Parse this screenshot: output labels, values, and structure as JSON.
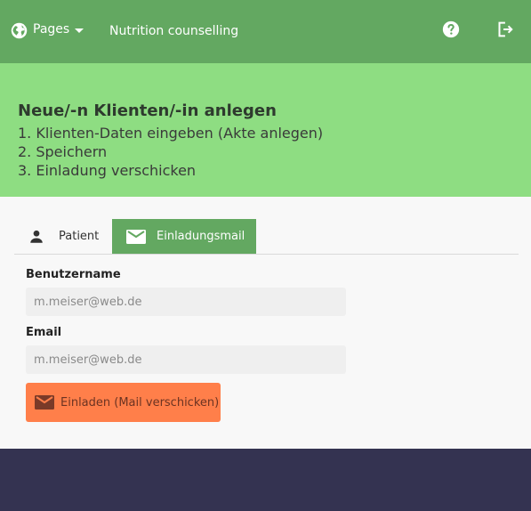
{
  "topbar": {
    "pages_label": "Pages",
    "app_title": "Nutrition counselling",
    "colors": {
      "bar": "#63a861"
    }
  },
  "banner": {
    "title": "Neue/-n Klienten/-in anlegen",
    "steps": [
      "1. Klienten-Daten eingeben (Akte anlegen)",
      "2. Speichern",
      "3. Einladung verschicken"
    ],
    "colors": {
      "background": "#8edd82"
    }
  },
  "tabs": [
    {
      "label": "Patient",
      "icon": "person-icon",
      "active": false
    },
    {
      "label": "Einladungsmail",
      "icon": "mail-icon",
      "active": true
    }
  ],
  "form": {
    "username_label": "Benutzername",
    "username_placeholder": "m.meiser@web.de",
    "email_label": "Email",
    "email_placeholder": "m.meiser@web.de",
    "invite_button": "Einladen (Mail verschicken)",
    "colors": {
      "button": "#ff7f4a"
    }
  },
  "footer": {
    "colors": {
      "background": "#343351"
    }
  }
}
